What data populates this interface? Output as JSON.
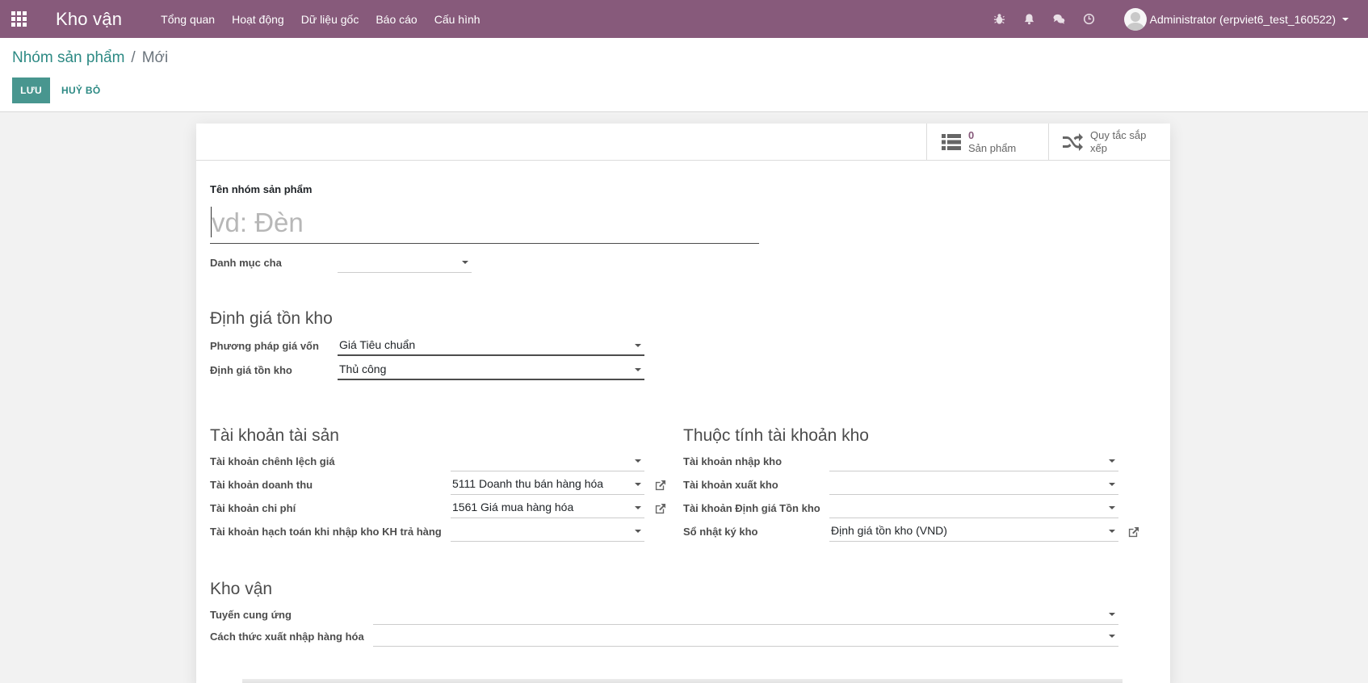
{
  "navbar": {
    "app_name": "Kho vận",
    "menu": [
      "Tổng quan",
      "Hoạt động",
      "Dữ liệu gốc",
      "Báo cáo",
      "Cấu hình"
    ],
    "user": "Administrator (erpviet6_test_160522)"
  },
  "breadcrumb": {
    "parent": "Nhóm sản phẩm",
    "separator": "/",
    "current": "Mới"
  },
  "buttons": {
    "save": "LƯU",
    "discard": "HUỶ BỎ"
  },
  "stat_buttons": {
    "products": {
      "value": "0",
      "label": "Sản phẩm"
    },
    "putaway": {
      "label_line1": "Quy tắc sắp",
      "label_line2": "xếp"
    }
  },
  "form": {
    "name_label": "Tên nhóm sản phẩm",
    "name_placeholder": "vd: Đèn",
    "name_value": "",
    "parent_label": "Danh mục cha",
    "parent_value": "",
    "valuation_section": {
      "title": "Định giá tồn kho",
      "cost_method_label": "Phương pháp giá vốn",
      "cost_method_value": "Giá Tiêu chuẩn",
      "valuation_label": "Định giá tồn kho",
      "valuation_value": "Thủ công"
    },
    "account_section": {
      "title": "Tài khoản tài sản",
      "price_diff_label": "Tài khoản chênh lệch giá",
      "price_diff_value": "",
      "income_label": "Tài khoản doanh thu",
      "income_value": "5111 Doanh thu bán hàng hóa",
      "expense_label": "Tài khoản chi phí",
      "expense_value": "1561 Giá mua hàng hóa",
      "return_label": "Tài khoản hạch toán khi nhập kho KH trả hàng",
      "return_value": ""
    },
    "stock_account_section": {
      "title": "Thuộc tính tài khoản kho",
      "input_label": "Tài khoản nhập kho",
      "input_value": "",
      "output_label": "Tài khoản xuất kho",
      "output_value": "",
      "valuation_acc_label": "Tài khoản Định giá Tồn kho",
      "valuation_acc_value": "",
      "journal_label": "Sổ nhật ký kho",
      "journal_value": "Định giá tồn kho (VND)"
    },
    "logistics_section": {
      "title": "Kho vận",
      "routes_label": "Tuyến cung ứng",
      "routes_value": "",
      "removal_label": "Cách thức xuất nhập hàng hóa",
      "removal_value": ""
    }
  },
  "colors": {
    "navbar": "#875a7b",
    "primary_button": "#48968f",
    "link": "#2d8a84",
    "stat_value": "#875a7b"
  }
}
